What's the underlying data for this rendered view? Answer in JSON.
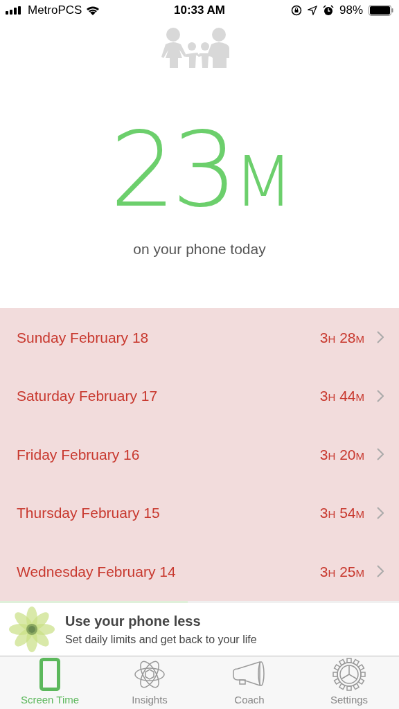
{
  "status_bar": {
    "carrier": "MetroPCS",
    "time": "10:33 AM",
    "battery": "98%"
  },
  "today": {
    "duration": "23M",
    "caption": "on your phone today"
  },
  "days": [
    {
      "label": "Sunday February 18",
      "duration": "3H 28M"
    },
    {
      "label": "Saturday February 17",
      "duration": "3H 44M"
    },
    {
      "label": "Friday February 16",
      "duration": "3H 20M"
    },
    {
      "label": "Thursday February 15",
      "duration": "3H 54M"
    },
    {
      "label": "Wednesday February 14",
      "duration": "3H 25M"
    }
  ],
  "progress": {
    "level": 0.47
  },
  "banner": {
    "title": "Use your phone less",
    "subtitle": "Set daily limits and get back to your life"
  },
  "tabs": [
    {
      "label": "Screen Time",
      "kind": "phone",
      "selected": true
    },
    {
      "label": "Insights",
      "kind": "atom",
      "selected": false
    },
    {
      "label": "Coach",
      "kind": "megaphone",
      "selected": false
    },
    {
      "label": "Settings",
      "kind": "gear",
      "selected": false
    }
  ]
}
